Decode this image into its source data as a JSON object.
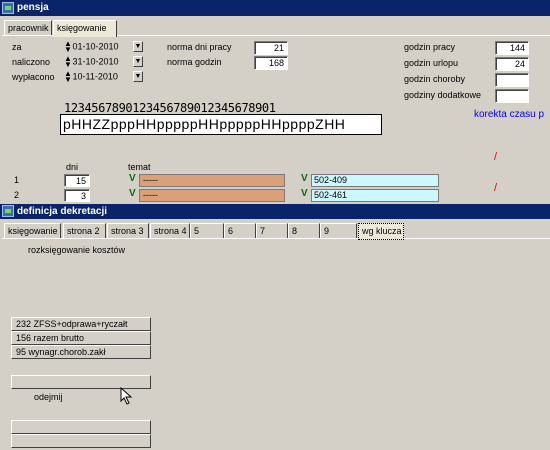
{
  "window1": {
    "title": "pensja",
    "tabs": [
      "pracownik",
      "księgowanie"
    ],
    "za_label": "za",
    "za_value": "01-10-2010",
    "naliczono_label": "naliczono",
    "naliczono_value": "31-10-2010",
    "wyplacono_label": "wypłacono",
    "wyplacono_value": "10-11-2010",
    "norma_dni_label": "norma dni pracy",
    "norma_dni_value": "21",
    "norma_godzin_label": "norma godzin",
    "norma_godzin_value": "168",
    "godzin_pracy_label": "godzin pracy",
    "godzin_pracy_value": "144",
    "godzin_urlopu_label": "godzin urlopu",
    "godzin_urlopu_value": "24",
    "godzin_choroby_label": "godzin choroby",
    "godzin_choroby_value": "",
    "godziny_dodatkowe_label": "godziny dodatkowe",
    "godziny_dodatkowe_value": "",
    "day_numbers": "1234567890123456789012345678901",
    "day_codes": "pHHZZpppHHpppppHHpppppHHppppZHH",
    "korekta": "korekta czasu p",
    "dni_header": "dni",
    "temat_header": "temat",
    "rows": [
      {
        "n": "1",
        "dni": "15",
        "temat": "-----",
        "konto": "502-409",
        "mark": "/"
      },
      {
        "n": "2",
        "dni": "3",
        "temat": "-----",
        "konto": "502-461",
        "mark": "/"
      }
    ],
    "check_symbol": "V"
  },
  "window2": {
    "title": "definicja dekretacji",
    "tabs": [
      "księgowanie",
      "strona 2",
      "strona 3",
      "strona 4",
      "5",
      "6",
      "7",
      "8",
      "9",
      "wg klucza"
    ],
    "section_label": "rozksięgowanie kosztów",
    "list_buttons": [
      "232  ZFSS+odprawa+ryczałt",
      "156  razem brutto",
      "95  wynagr.chorob.zakł"
    ],
    "odejmij_label": "odejmij"
  },
  "colors": {
    "titlebar": "#0a246a",
    "topic_field": "#d9a07a",
    "account_field": "#cdf7ff",
    "link_text": "#0000ff",
    "error_mark": "#e00000"
  }
}
